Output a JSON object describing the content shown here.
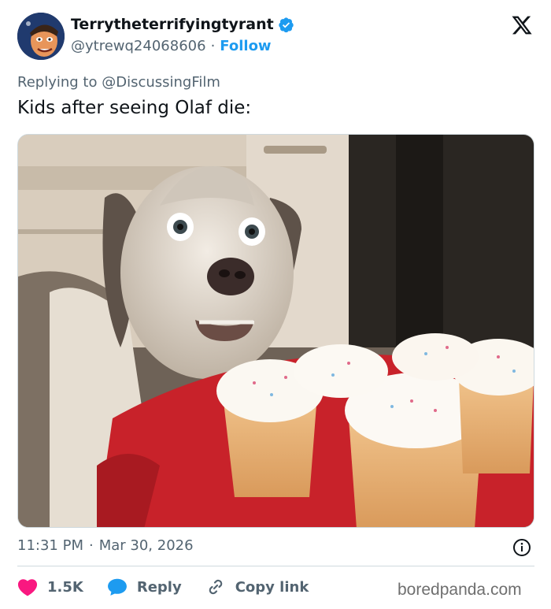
{
  "user": {
    "display_name": "Terrytheterrifyingtyrant",
    "handle": "@ytrewq24068606",
    "separator": "·",
    "follow_label": "Follow",
    "verified": true,
    "avatar_icon": "avatar-cartoon"
  },
  "reply": {
    "prefix": "Replying to ",
    "target": "@DiscussingFilm"
  },
  "post": {
    "text": "Kids after seeing Olaf die:",
    "media_description_icon": "gif-dog-cupcakes"
  },
  "meta": {
    "time": "11:31 PM",
    "separator": "·",
    "date": "Mar 30, 2026"
  },
  "actions": {
    "like_count": "1.5K",
    "reply_label": "Reply",
    "copy_link_label": "Copy link"
  },
  "watermark": "boredpanda.com",
  "colors": {
    "accent": "#1d9bf0",
    "like": "#f91880",
    "text": "#0f1419",
    "muted": "#536471"
  }
}
